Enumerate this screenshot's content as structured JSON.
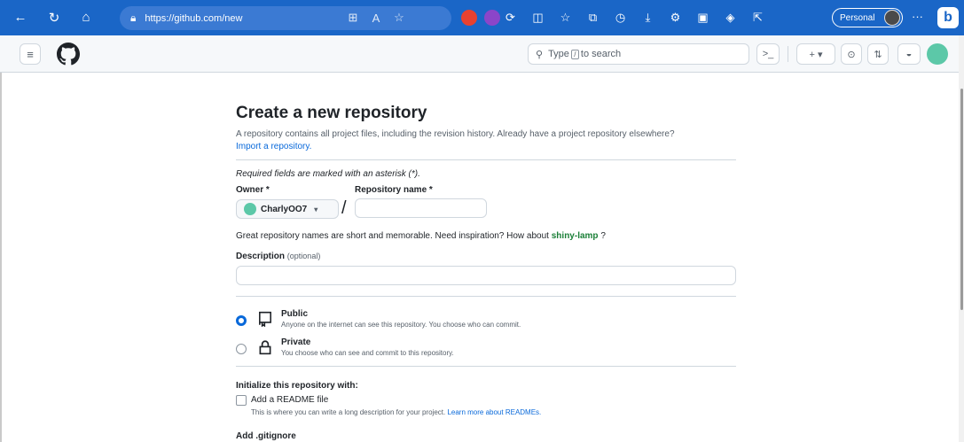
{
  "browser": {
    "url": "https://github.com/new",
    "profile_label": "Personal",
    "more": "···",
    "bing_letter": "b"
  },
  "header": {
    "search_placeholder": "Type / to search",
    "search_prefix": "Type",
    "search_key": "/",
    "search_suffix": "to search",
    "terminal_label": ">_",
    "plus_label": "+ ▾"
  },
  "form": {
    "title": "Create a new repository",
    "lead": "A repository contains all project files, including the revision history. Already have a project repository elsewhere?",
    "import_link": "Import a repository.",
    "required_note": "Required fields are marked with an asterisk (*).",
    "owner_label": "Owner *",
    "owner_value": "CharlyOO7",
    "repo_name_label": "Repository name *",
    "slash": "/",
    "repo_name_value": "",
    "name_hint": "Great repository names are short and memorable. Need inspiration? How about",
    "name_suggestion": "shiny-lamp",
    "name_hint_end": "?",
    "description_label": "Description",
    "description_optional": "(optional)",
    "description_value": "",
    "visibility": [
      {
        "name": "Public",
        "description": "Anyone on the internet can see this repository. You choose who can commit.",
        "selected": true
      },
      {
        "name": "Private",
        "description": "You choose who can see and commit to this repository.",
        "selected": false
      }
    ],
    "init_heading": "Initialize this repository with:",
    "readme_label": "Add a README file",
    "readme_desc": "This is where you can write a long description for your project.",
    "readme_link": "Learn more about READMEs.",
    "readme_checked": false,
    "gitignore_label": "Add .gitignore"
  },
  "colors": {
    "browser_bar": "#1a66c7",
    "link": "#0969da",
    "suggestion": "#1a7f37",
    "avatar": "#5cc8a8"
  }
}
